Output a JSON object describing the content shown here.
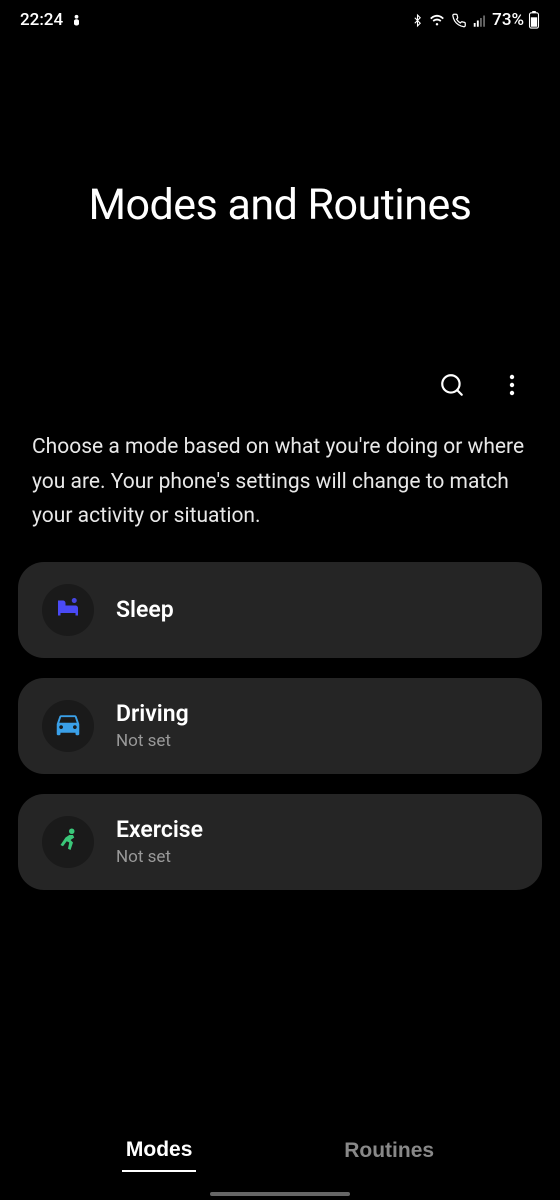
{
  "status_bar": {
    "time": "22:24",
    "battery_text": "73%"
  },
  "header": {
    "title": "Modes and Routines"
  },
  "description": "Choose a mode based on what you're doing or where you are. Your phone's settings will change to match your activity or situation.",
  "modes": [
    {
      "id": "sleep",
      "title": "Sleep",
      "subtitle": "",
      "icon_color": "#4a4af5"
    },
    {
      "id": "driving",
      "title": "Driving",
      "subtitle": "Not set",
      "icon_color": "#3aa0e8"
    },
    {
      "id": "exercise",
      "title": "Exercise",
      "subtitle": "Not set",
      "icon_color": "#3ac779"
    }
  ],
  "tabs": [
    {
      "label": "Modes",
      "active": true
    },
    {
      "label": "Routines",
      "active": false
    }
  ]
}
